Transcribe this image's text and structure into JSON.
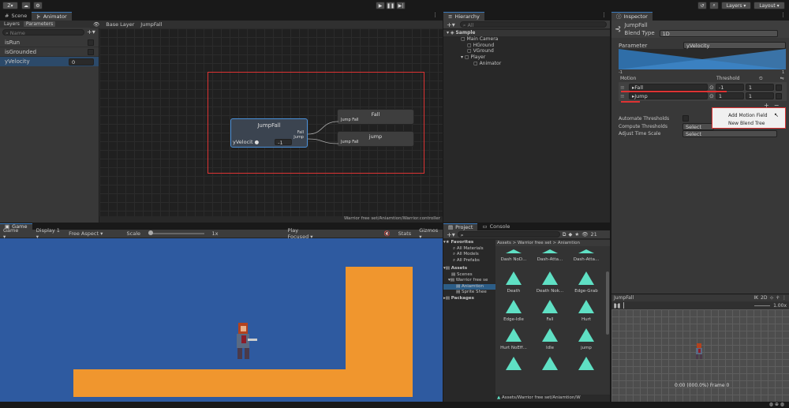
{
  "top": {
    "account": "Z",
    "play_controls": [
      "play",
      "pause",
      "step"
    ],
    "layers": "Layers",
    "layout": "Layout"
  },
  "animator": {
    "tabs": [
      "Scene",
      "Animator"
    ],
    "subtabs": [
      "Layers",
      "Parameters"
    ],
    "search_placeholder": "Name",
    "breadcrumb": "Base Layer",
    "breadcrumb_current": "JumpFall",
    "params": [
      {
        "name": "isRun",
        "type": "bool"
      },
      {
        "name": "isGrounded",
        "type": "bool"
      },
      {
        "name": "yVelocity",
        "type": "float",
        "value": "0"
      }
    ],
    "node": {
      "title": "JumpFall",
      "param": "yVelocit",
      "value": "-1",
      "out1": "Fall",
      "out2": "Jump"
    },
    "targets": [
      {
        "title": "Fall",
        "port": "Jump Fall"
      },
      {
        "title": "jump",
        "port": "Jump Fall"
      }
    ],
    "footer": "Warrior free set/Aniamtion/Warrior.controller"
  },
  "hierarchy": {
    "tab": "Hierarchy",
    "search_placeholder": "All",
    "items": [
      "Sample",
      "Main Camera",
      "HGround",
      "VGround",
      "Player",
      "Animator"
    ]
  },
  "inspector": {
    "tab": "Inspector",
    "name": "JumpFall",
    "blend_type_label": "Blend Type",
    "blend_type": "1D",
    "parameter_label": "Parameter",
    "parameter": "yVelocity",
    "range_min": "-1",
    "range_max": "1",
    "motion_label": "Motion",
    "threshold_label": "Threshold",
    "motions": [
      {
        "name": "Fall",
        "threshold": "-1",
        "speed": "1"
      },
      {
        "name": "Jump",
        "threshold": "1",
        "speed": "1"
      }
    ],
    "add_menu": [
      "Add Motion Field",
      "New Blend Tree"
    ],
    "automate": "Automate Thresholds",
    "compute": "Compute Thresholds",
    "compute_value": "Select",
    "adjust": "Adjust Time Scale",
    "adjust_value": "Select"
  },
  "game": {
    "tab": "Game",
    "mode": "Game",
    "display": "Display 1",
    "aspect": "Free Aspect",
    "scale_label": "Scale",
    "scale_value": "1x",
    "play_focused": "Play Focused",
    "stats": "Stats",
    "gizmos": "Gizmos"
  },
  "project": {
    "tabs": [
      "Project",
      "Console"
    ],
    "count": "21",
    "path": "Assets > Warrior free set > Aniamtion",
    "tree": {
      "favorites": "Favorites",
      "fav_items": [
        "All Materials",
        "All Models",
        "All Prefabs"
      ],
      "assets": "Assets",
      "asset_items": [
        "Scenes",
        "Warrior free se",
        "Aniamtion",
        "Sprite Shee"
      ],
      "packages": "Packages"
    },
    "top_row": [
      "Dash NoD...",
      "Dash-Atta...",
      "Dash-Atta..."
    ],
    "assets": [
      "Death",
      "Death Nok...",
      "Edge-Grab",
      "Edge-Idle",
      "Fall",
      "Hurt",
      "Hurt NoEff...",
      "Idle",
      "jump",
      "",
      "",
      ""
    ],
    "footer": "Assets/Warrior free set/Aniamtion/W"
  },
  "preview": {
    "name": "JumpFall",
    "ik": "IK",
    "speed": "1.00x",
    "time": "0:00 (000.0%) Frame 0"
  }
}
